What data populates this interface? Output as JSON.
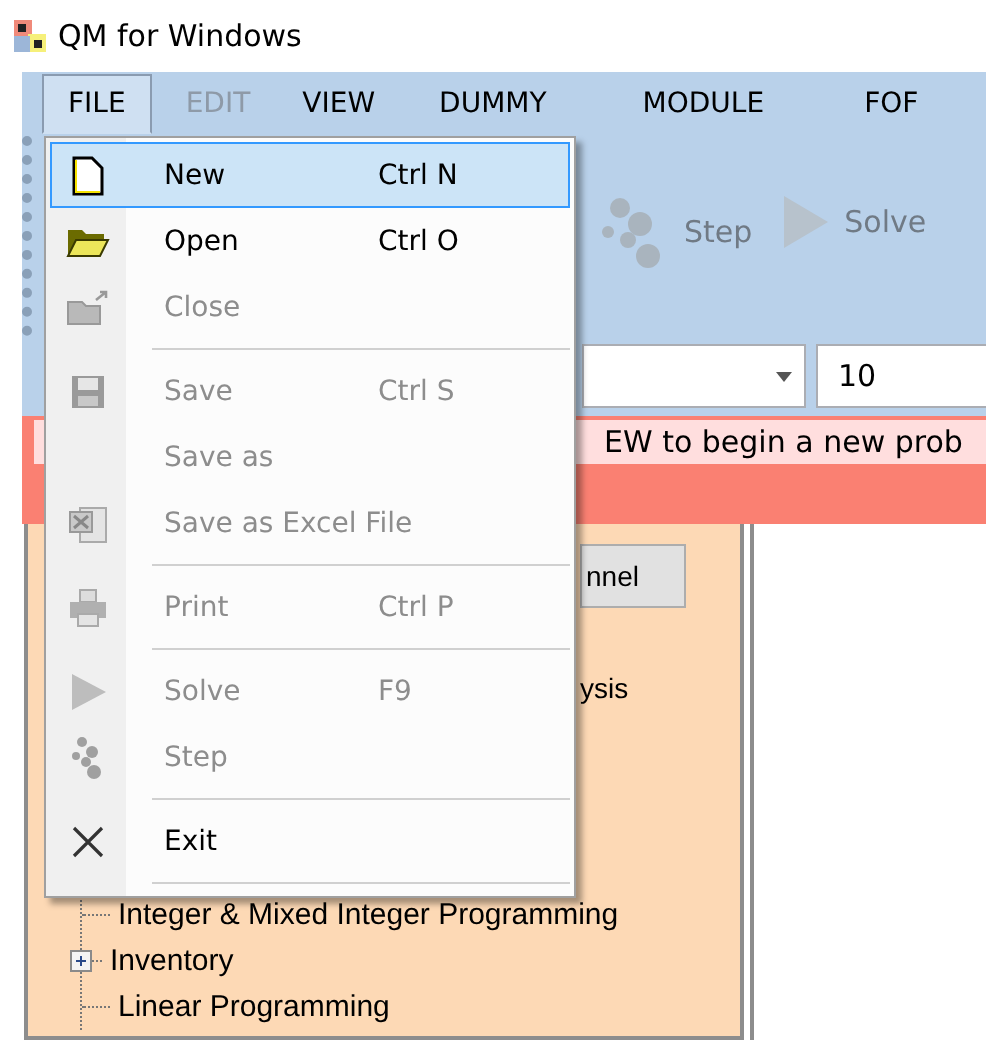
{
  "window": {
    "title": "QM for Windows"
  },
  "menubar": [
    {
      "label": "FILE",
      "selected": true,
      "disabled": false
    },
    {
      "label": "EDIT",
      "selected": false,
      "disabled": true
    },
    {
      "label": "VIEW",
      "selected": false,
      "disabled": false
    },
    {
      "label": "DUMMY",
      "selected": false,
      "disabled": false
    },
    {
      "label": "MODULE",
      "selected": false,
      "disabled": false
    },
    {
      "label": "FOF",
      "selected": false,
      "disabled": false
    }
  ],
  "toolbar": [
    {
      "label": "Step"
    },
    {
      "label": "Solve"
    }
  ],
  "size_field": {
    "value": "10"
  },
  "message": "EW to begin a new prob",
  "left_panel": {
    "button": "nnel",
    "text": "ysis",
    "tree": [
      {
        "kind": "leaf",
        "label": "Integer & Mixed Integer Programming"
      },
      {
        "kind": "branch",
        "label": "Inventory"
      },
      {
        "kind": "leaf",
        "label": "Linear Programming"
      }
    ]
  },
  "file_menu": [
    {
      "kind": "item",
      "label": "New",
      "shortcut": "Ctrl N",
      "disabled": false,
      "selected": true
    },
    {
      "kind": "item",
      "label": "Open",
      "shortcut": "Ctrl O",
      "disabled": false,
      "selected": false
    },
    {
      "kind": "item",
      "label": "Close",
      "disabled": true,
      "selected": false
    },
    {
      "kind": "separator"
    },
    {
      "kind": "item",
      "label": "Save",
      "shortcut": "Ctrl S",
      "disabled": true,
      "selected": false
    },
    {
      "kind": "item",
      "label": "Save as",
      "disabled": true,
      "selected": false
    },
    {
      "kind": "item",
      "label": "Save as Excel File",
      "disabled": true,
      "selected": false
    },
    {
      "kind": "separator"
    },
    {
      "kind": "item",
      "label": "Print",
      "shortcut": "Ctrl P",
      "disabled": true,
      "selected": false
    },
    {
      "kind": "separator"
    },
    {
      "kind": "item",
      "label": "Solve",
      "shortcut": "F9",
      "disabled": true,
      "selected": false
    },
    {
      "kind": "item",
      "label": "Step",
      "disabled": true,
      "selected": false
    },
    {
      "kind": "separator"
    },
    {
      "kind": "item",
      "label": "Exit",
      "disabled": false,
      "selected": false
    },
    {
      "kind": "separator"
    }
  ]
}
